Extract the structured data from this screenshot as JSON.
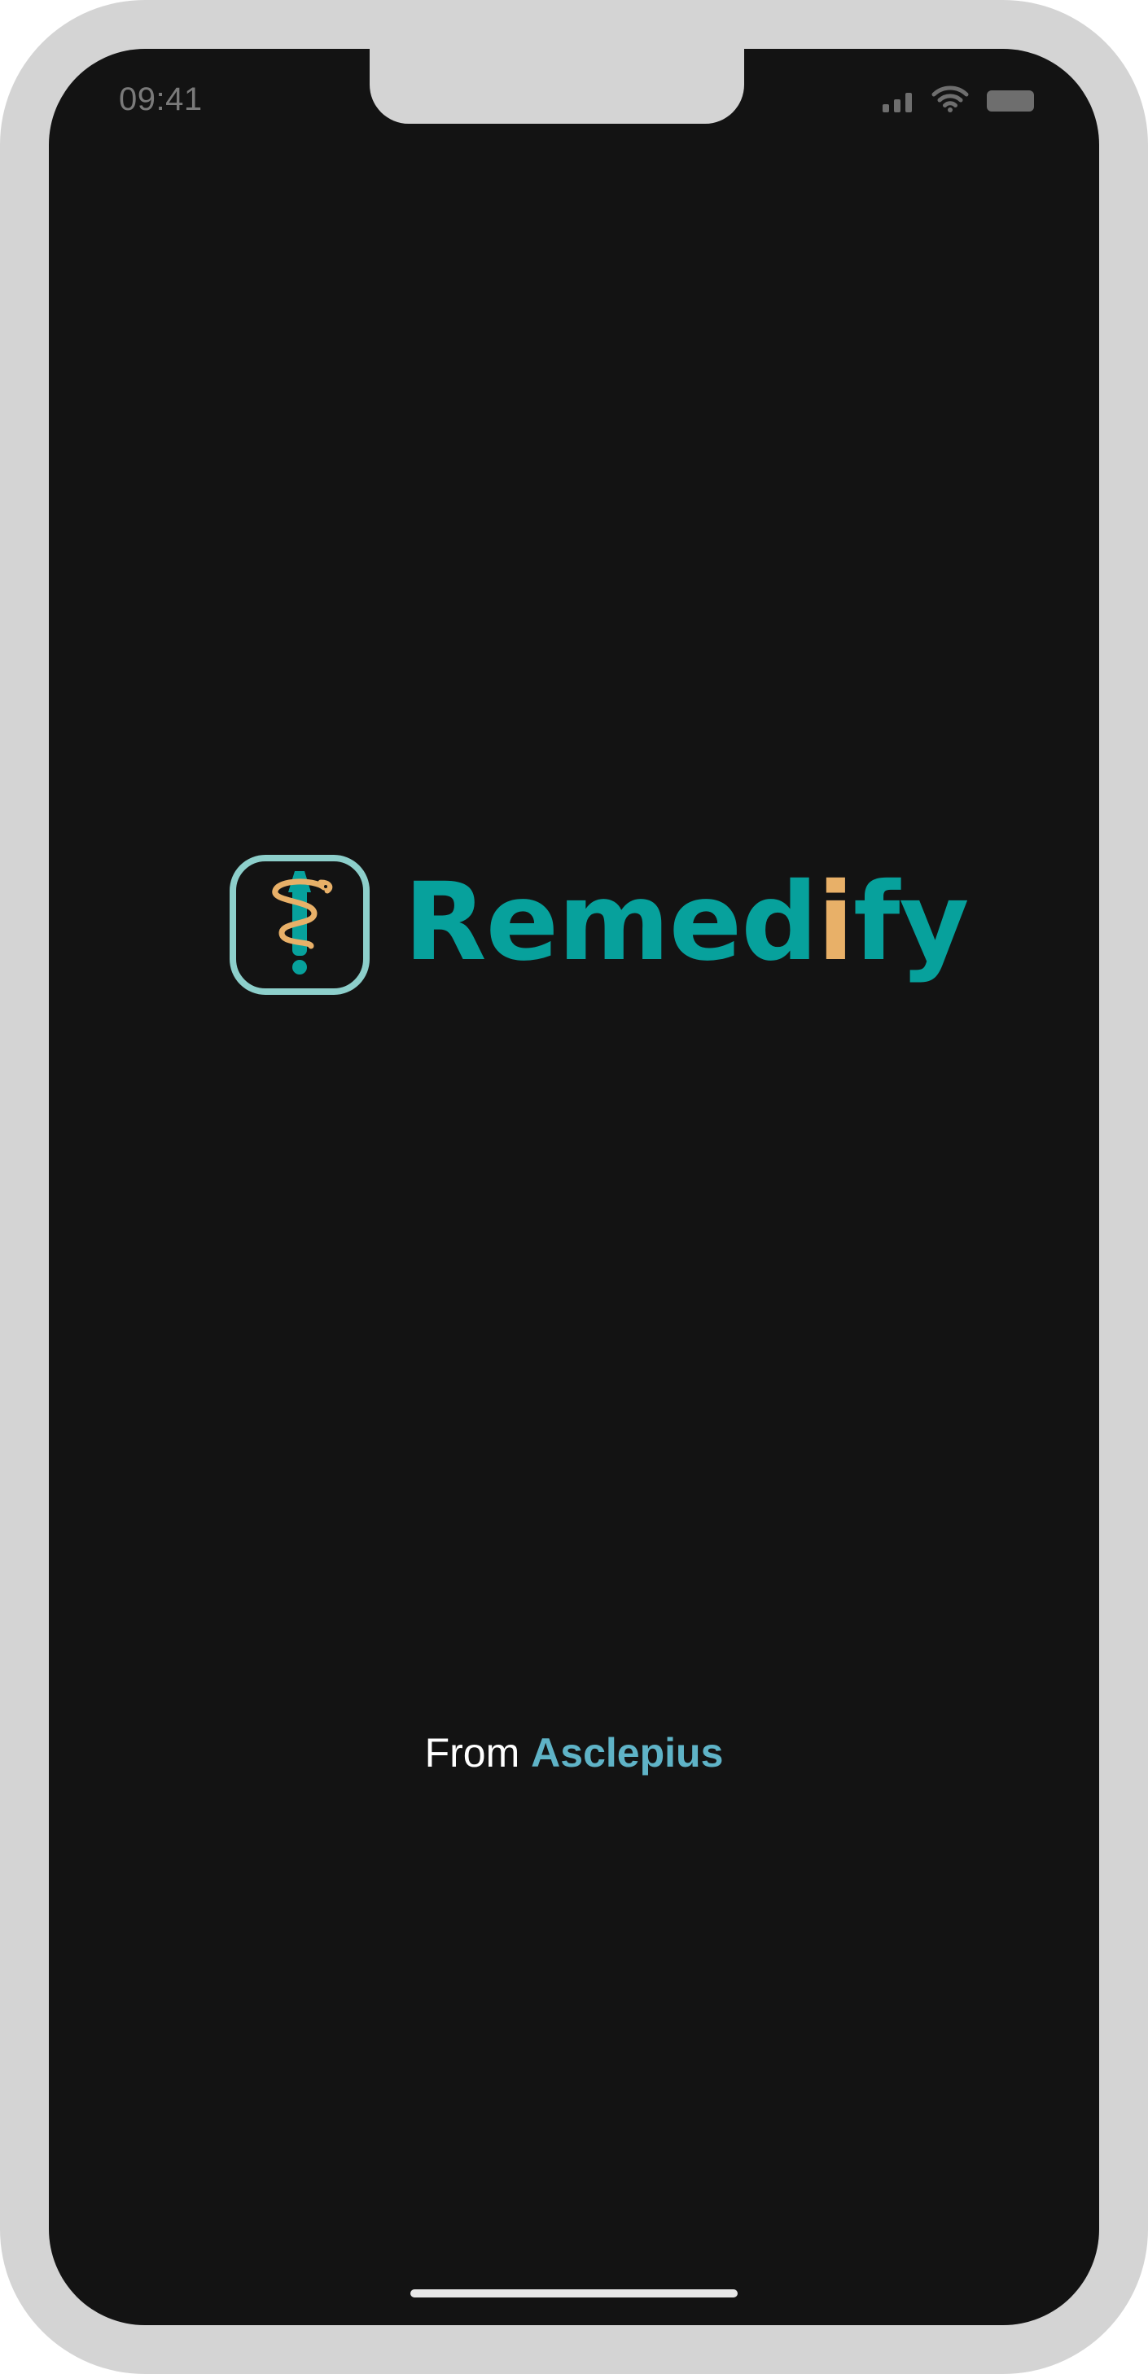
{
  "status_bar": {
    "time": "09:41",
    "icons": [
      "signal-icon",
      "wifi-icon",
      "battery-icon"
    ]
  },
  "logo": {
    "mark_icon": "rod-of-asclepius-icon",
    "wordmark_part1": "Reme",
    "wordmark_part2": "d",
    "wordmark_highlight": "i",
    "wordmark_part3": "fy"
  },
  "footer": {
    "prefix": "From",
    "brand": "Asclepius"
  },
  "colors": {
    "background": "#131313",
    "frame": "#d4d4d4",
    "teal": "#07a19c",
    "gold": "#e8b068",
    "mark_border": "#8dcfcb",
    "accent_blue": "#5fb3c7"
  }
}
